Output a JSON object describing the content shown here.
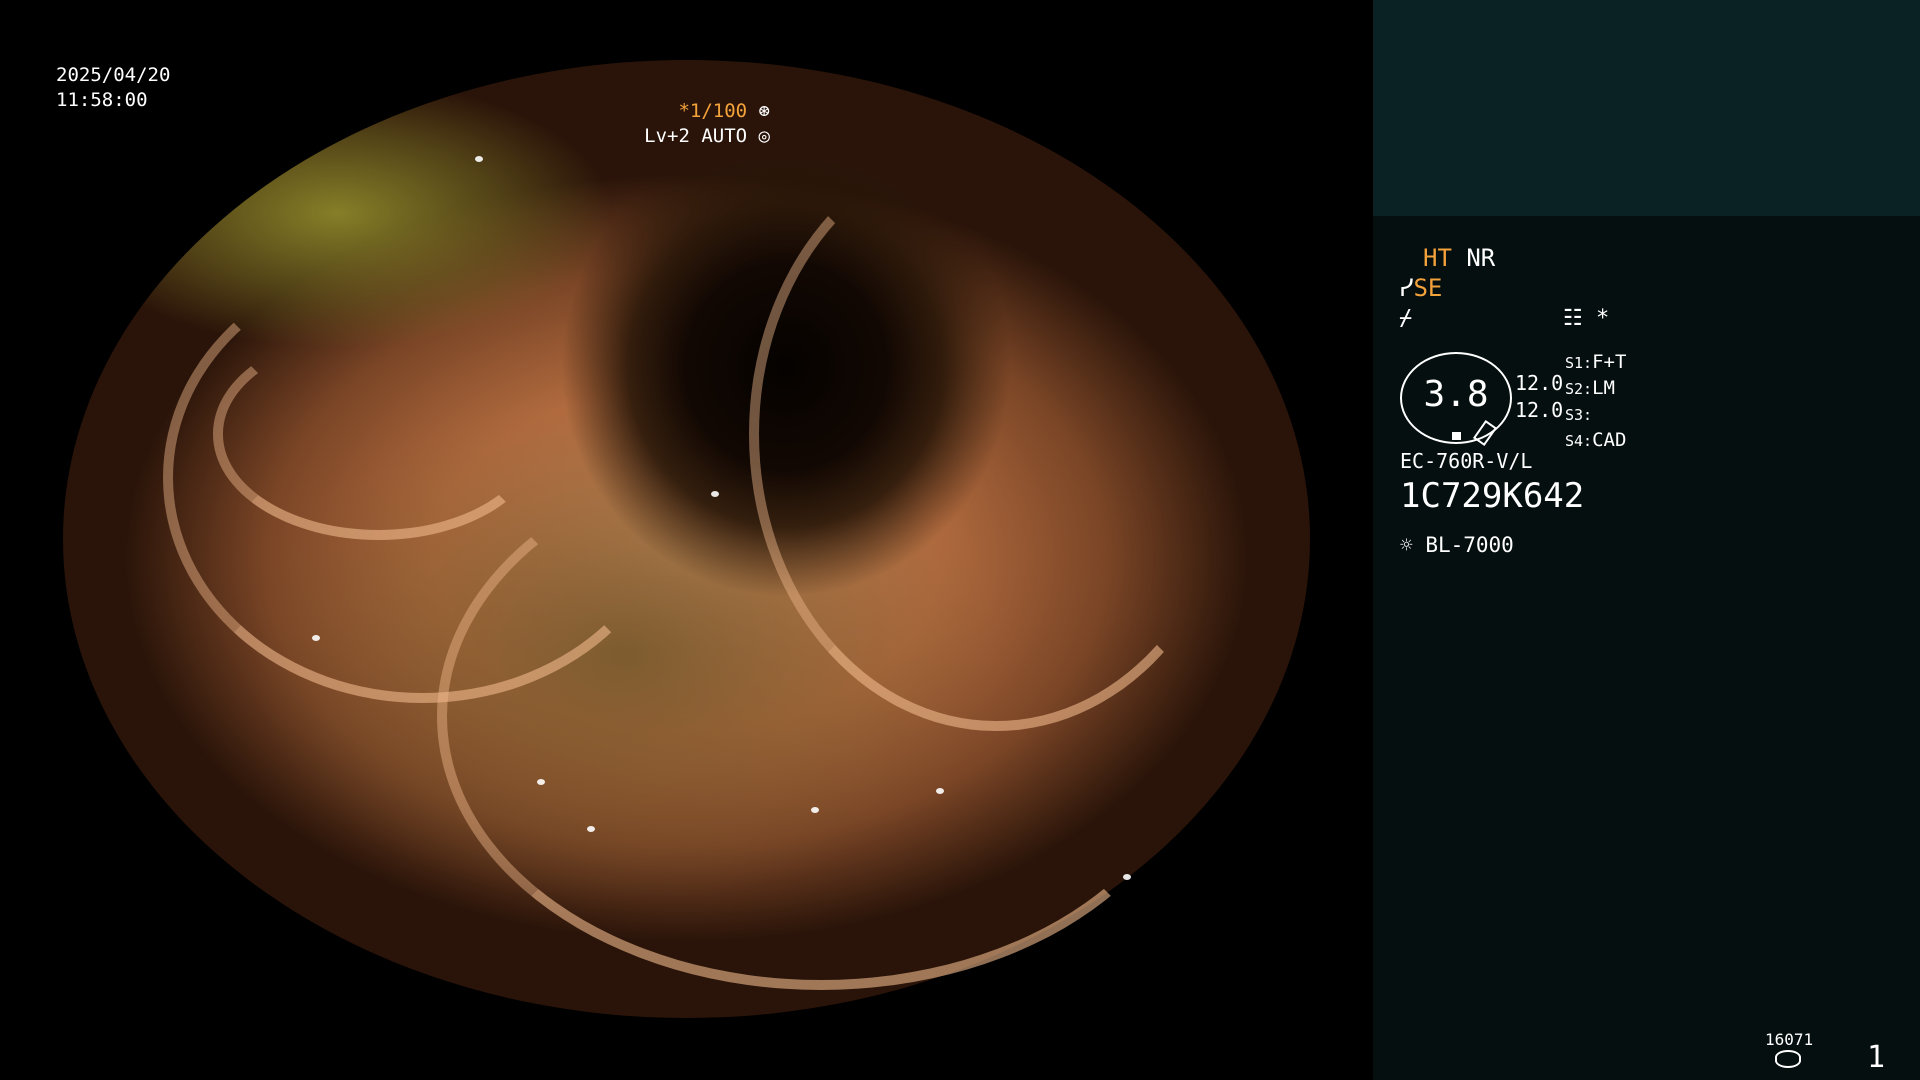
{
  "overlay": {
    "date": "2025/04/20",
    "time": "11:58:00",
    "shutter": "*1/100",
    "shutter_icon": "aperture-icon",
    "exposure": "Lv+2 AUTO",
    "exposure_icon": "iris-icon"
  },
  "panel": {
    "mode_ht": "HT",
    "mode_nr": "NR",
    "mode_se": "SE",
    "se_icon": "tilde-icon",
    "enhancement_icon": "enhancement-icon",
    "menu_icon": "settings-list-icon",
    "asterisk": "*",
    "gauge_value": "3.8",
    "gauge_right_a": "12.0",
    "gauge_right_b": "12.0",
    "switches": [
      {
        "label": "S1:",
        "value": "F+T"
      },
      {
        "label": "S2:",
        "value": "LM"
      },
      {
        "label": "S3:",
        "value": ""
      },
      {
        "label": "S4:",
        "value": "CAD"
      }
    ],
    "scope_model": "EC-760R-V/L",
    "scope_serial": "1C729K642",
    "light_source_icon": "lamp-icon",
    "light_source": "BL-7000",
    "frame_count": "16071",
    "storage_icon": "disk-icon",
    "page_number": "1"
  },
  "colors": {
    "highlight": "#f4a23a",
    "panel_top": "#0b2224",
    "panel_bottom": "#050f10"
  }
}
